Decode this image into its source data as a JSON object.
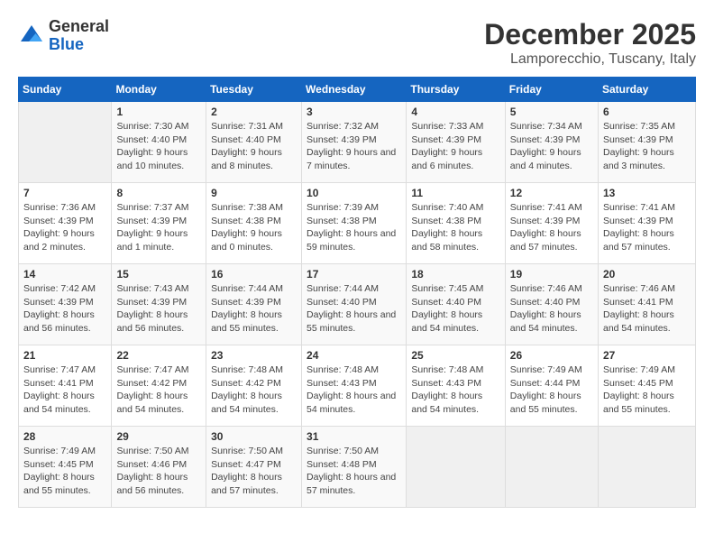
{
  "logo": {
    "general": "General",
    "blue": "Blue"
  },
  "title": "December 2025",
  "location": "Lamporecchio, Tuscany, Italy",
  "days_of_week": [
    "Sunday",
    "Monday",
    "Tuesday",
    "Wednesday",
    "Thursday",
    "Friday",
    "Saturday"
  ],
  "weeks": [
    [
      {
        "day": "",
        "sunrise": "",
        "sunset": "",
        "daylight": "",
        "empty": true
      },
      {
        "day": "1",
        "sunrise": "Sunrise: 7:30 AM",
        "sunset": "Sunset: 4:40 PM",
        "daylight": "Daylight: 9 hours and 10 minutes."
      },
      {
        "day": "2",
        "sunrise": "Sunrise: 7:31 AM",
        "sunset": "Sunset: 4:40 PM",
        "daylight": "Daylight: 9 hours and 8 minutes."
      },
      {
        "day": "3",
        "sunrise": "Sunrise: 7:32 AM",
        "sunset": "Sunset: 4:39 PM",
        "daylight": "Daylight: 9 hours and 7 minutes."
      },
      {
        "day": "4",
        "sunrise": "Sunrise: 7:33 AM",
        "sunset": "Sunset: 4:39 PM",
        "daylight": "Daylight: 9 hours and 6 minutes."
      },
      {
        "day": "5",
        "sunrise": "Sunrise: 7:34 AM",
        "sunset": "Sunset: 4:39 PM",
        "daylight": "Daylight: 9 hours and 4 minutes."
      },
      {
        "day": "6",
        "sunrise": "Sunrise: 7:35 AM",
        "sunset": "Sunset: 4:39 PM",
        "daylight": "Daylight: 9 hours and 3 minutes."
      }
    ],
    [
      {
        "day": "7",
        "sunrise": "Sunrise: 7:36 AM",
        "sunset": "Sunset: 4:39 PM",
        "daylight": "Daylight: 9 hours and 2 minutes."
      },
      {
        "day": "8",
        "sunrise": "Sunrise: 7:37 AM",
        "sunset": "Sunset: 4:39 PM",
        "daylight": "Daylight: 9 hours and 1 minute."
      },
      {
        "day": "9",
        "sunrise": "Sunrise: 7:38 AM",
        "sunset": "Sunset: 4:38 PM",
        "daylight": "Daylight: 9 hours and 0 minutes."
      },
      {
        "day": "10",
        "sunrise": "Sunrise: 7:39 AM",
        "sunset": "Sunset: 4:38 PM",
        "daylight": "Daylight: 8 hours and 59 minutes."
      },
      {
        "day": "11",
        "sunrise": "Sunrise: 7:40 AM",
        "sunset": "Sunset: 4:38 PM",
        "daylight": "Daylight: 8 hours and 58 minutes."
      },
      {
        "day": "12",
        "sunrise": "Sunrise: 7:41 AM",
        "sunset": "Sunset: 4:39 PM",
        "daylight": "Daylight: 8 hours and 57 minutes."
      },
      {
        "day": "13",
        "sunrise": "Sunrise: 7:41 AM",
        "sunset": "Sunset: 4:39 PM",
        "daylight": "Daylight: 8 hours and 57 minutes."
      }
    ],
    [
      {
        "day": "14",
        "sunrise": "Sunrise: 7:42 AM",
        "sunset": "Sunset: 4:39 PM",
        "daylight": "Daylight: 8 hours and 56 minutes."
      },
      {
        "day": "15",
        "sunrise": "Sunrise: 7:43 AM",
        "sunset": "Sunset: 4:39 PM",
        "daylight": "Daylight: 8 hours and 56 minutes."
      },
      {
        "day": "16",
        "sunrise": "Sunrise: 7:44 AM",
        "sunset": "Sunset: 4:39 PM",
        "daylight": "Daylight: 8 hours and 55 minutes."
      },
      {
        "day": "17",
        "sunrise": "Sunrise: 7:44 AM",
        "sunset": "Sunset: 4:40 PM",
        "daylight": "Daylight: 8 hours and 55 minutes."
      },
      {
        "day": "18",
        "sunrise": "Sunrise: 7:45 AM",
        "sunset": "Sunset: 4:40 PM",
        "daylight": "Daylight: 8 hours and 54 minutes."
      },
      {
        "day": "19",
        "sunrise": "Sunrise: 7:46 AM",
        "sunset": "Sunset: 4:40 PM",
        "daylight": "Daylight: 8 hours and 54 minutes."
      },
      {
        "day": "20",
        "sunrise": "Sunrise: 7:46 AM",
        "sunset": "Sunset: 4:41 PM",
        "daylight": "Daylight: 8 hours and 54 minutes."
      }
    ],
    [
      {
        "day": "21",
        "sunrise": "Sunrise: 7:47 AM",
        "sunset": "Sunset: 4:41 PM",
        "daylight": "Daylight: 8 hours and 54 minutes."
      },
      {
        "day": "22",
        "sunrise": "Sunrise: 7:47 AM",
        "sunset": "Sunset: 4:42 PM",
        "daylight": "Daylight: 8 hours and 54 minutes."
      },
      {
        "day": "23",
        "sunrise": "Sunrise: 7:48 AM",
        "sunset": "Sunset: 4:42 PM",
        "daylight": "Daylight: 8 hours and 54 minutes."
      },
      {
        "day": "24",
        "sunrise": "Sunrise: 7:48 AM",
        "sunset": "Sunset: 4:43 PM",
        "daylight": "Daylight: 8 hours and 54 minutes."
      },
      {
        "day": "25",
        "sunrise": "Sunrise: 7:48 AM",
        "sunset": "Sunset: 4:43 PM",
        "daylight": "Daylight: 8 hours and 54 minutes."
      },
      {
        "day": "26",
        "sunrise": "Sunrise: 7:49 AM",
        "sunset": "Sunset: 4:44 PM",
        "daylight": "Daylight: 8 hours and 55 minutes."
      },
      {
        "day": "27",
        "sunrise": "Sunrise: 7:49 AM",
        "sunset": "Sunset: 4:45 PM",
        "daylight": "Daylight: 8 hours and 55 minutes."
      }
    ],
    [
      {
        "day": "28",
        "sunrise": "Sunrise: 7:49 AM",
        "sunset": "Sunset: 4:45 PM",
        "daylight": "Daylight: 8 hours and 55 minutes."
      },
      {
        "day": "29",
        "sunrise": "Sunrise: 7:50 AM",
        "sunset": "Sunset: 4:46 PM",
        "daylight": "Daylight: 8 hours and 56 minutes."
      },
      {
        "day": "30",
        "sunrise": "Sunrise: 7:50 AM",
        "sunset": "Sunset: 4:47 PM",
        "daylight": "Daylight: 8 hours and 57 minutes."
      },
      {
        "day": "31",
        "sunrise": "Sunrise: 7:50 AM",
        "sunset": "Sunset: 4:48 PM",
        "daylight": "Daylight: 8 hours and 57 minutes."
      },
      {
        "day": "",
        "empty": true
      },
      {
        "day": "",
        "empty": true
      },
      {
        "day": "",
        "empty": true
      }
    ]
  ]
}
